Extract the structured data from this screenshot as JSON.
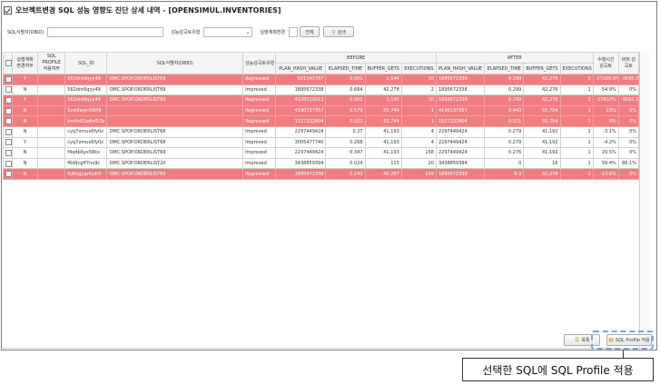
{
  "title": "오브젝트변경 SQL 성능 영향도 진단 상세 내역 - [OPENSIMUL.INVENTORIES]",
  "filters": {
    "sql_id_label": "SQL식별자(DBID)",
    "sql_id_value": "",
    "perf_type_label": "성능감곡토유형",
    "perf_type_value": "",
    "plan_change_label": "실행계획변경",
    "all_button": "전체",
    "search_button": "검색"
  },
  "table": {
    "group_headers": {
      "before": "BEFORE",
      "after": "AFTER"
    },
    "headers": {
      "plan_changed": "실행계획 변경여부",
      "sql_profile": "SQL PROFILE 적용여부",
      "sql_id": "SQL_ID",
      "sql_ident": "SQL식별자(DBID)",
      "perf_type": "성능감곡토유형",
      "plan_hash_value": "PLAN_HASH_VALUE",
      "elapsed_time": "ELAPSED_TIME",
      "buffer_gets": "BUFFER_GETS",
      "executions": "EXECUTIONS",
      "improve_time": "수행시간 감곡토",
      "ratio": "버퍼 감곡토"
    },
    "rows": [
      {
        "hl": true,
        "plan_changed": "Y",
        "sql_profile": "",
        "sql_id": "562dnt6qyy49",
        "sql_ident": "OMC.SPOP.ORDERLIST69",
        "perf_type": "Regressed",
        "b_plan": "921143787",
        "b_elapsed": "0.001",
        "b_buffer": "1,144",
        "b_exec": "10",
        "a_plan": "1895672338",
        "a_elapsed": "0.299",
        "a_buffer": "42,276",
        "a_exec": "2",
        "improve": "-27200.0%",
        "ratio": "-3595.3%"
      },
      {
        "hl": false,
        "plan_changed": "N",
        "sql_profile": "",
        "sql_id": "562dnt6qyy49",
        "sql_ident": "OMC.SPOP.ORDERLIST69",
        "perf_type": "Improved",
        "b_plan": "1895672338",
        "b_elapsed": "0.664",
        "b_buffer": "42,278",
        "b_exec": "2",
        "a_plan": "1895672338",
        "a_elapsed": "0.299",
        "a_buffer": "42,276",
        "a_exec": "1",
        "improve": "54.9%",
        "ratio": "0%"
      },
      {
        "hl": true,
        "plan_changed": "Y",
        "sql_profile": "",
        "sql_id": "562dnt6qyy49",
        "sql_ident": "OMC.SPOP.ORDERLIST69",
        "perf_type": "Regressed",
        "b_plan": "4108530012",
        "b_elapsed": "0.001",
        "b_buffer": "1,145",
        "b_exec": "10",
        "a_plan": "1895672338",
        "a_elapsed": "0.299",
        "a_buffer": "42,276",
        "a_exec": "1",
        "improve": "-27610%",
        "ratio": "-3592.2%"
      },
      {
        "hl": true,
        "plan_changed": "N",
        "sql_profile": "",
        "sql_id": "5xw8aqm5849",
        "sql_ident": "",
        "perf_type": "Regressed",
        "b_plan": "4190137357",
        "b_elapsed": "0.579",
        "b_buffer": "55,744",
        "b_exec": "1",
        "a_plan": "4190137357",
        "a_elapsed": "0.443",
        "a_buffer": "55,754",
        "a_exec": "1",
        "improve": "23%",
        "ratio": "0%"
      },
      {
        "hl": true,
        "plan_changed": "N",
        "sql_profile": "",
        "sql_id": "bm4c63q4vf57b",
        "sql_ident": "",
        "perf_type": "Regressed",
        "b_plan": "1527232804",
        "b_elapsed": "0.521",
        "b_buffer": "55,744",
        "b_exec": "1",
        "a_plan": "1527232804",
        "a_elapsed": "0.521",
        "a_buffer": "55,754",
        "a_exec": "1",
        "improve": "0%",
        "ratio": "0%"
      },
      {
        "hl": false,
        "plan_changed": "N",
        "sql_profile": "",
        "sql_id": "cyq7vmux6fy0z",
        "sql_ident": "OMC.SPOP.ORDERLIST68",
        "perf_type": "Improved",
        "b_plan": "2297449424",
        "b_elapsed": "0.27",
        "b_buffer": "41,193",
        "b_exec": "4",
        "a_plan": "2297449424",
        "a_elapsed": "0.279",
        "a_buffer": "41,192",
        "a_exec": "1",
        "improve": "-3.1%",
        "ratio": "0%"
      },
      {
        "hl": false,
        "plan_changed": "Y",
        "sql_profile": "",
        "sql_id": "cyq7vmux6fy0z",
        "sql_ident": "OMC.SPOP.ORDERLIST68",
        "perf_type": "Improved",
        "b_plan": "3005477740",
        "b_elapsed": "0.268",
        "b_buffer": "41,193",
        "b_exec": "4",
        "a_plan": "2297449424",
        "a_elapsed": "0.279",
        "a_buffer": "41,192",
        "a_exec": "1",
        "improve": "-4.2%",
        "ratio": "0%"
      },
      {
        "hl": false,
        "plan_changed": "N",
        "sql_profile": "",
        "sql_id": "f4q4b6yx58kx",
        "sql_ident": "OMC.SPOP.ORDERLIST69",
        "perf_type": "Improved",
        "b_plan": "2297449424",
        "b_elapsed": "0.347",
        "b_buffer": "41,193",
        "b_exec": "158",
        "a_plan": "2297449424",
        "a_elapsed": "0.276",
        "a_buffer": "41,192",
        "a_exec": "1",
        "improve": "20.5%",
        "ratio": "0%"
      },
      {
        "hl": false,
        "plan_changed": "N",
        "sql_profile": "",
        "sql_id": "f6dfjcgff7nx9c",
        "sql_ident": "OMC.SPOP.ORDERLIST20",
        "perf_type": "Improved",
        "b_plan": "3438859394",
        "b_elapsed": "0.024",
        "b_buffer": "115",
        "b_exec": "20",
        "a_plan": "3438859394",
        "a_elapsed": "0",
        "a_buffer": "16",
        "a_exec": "1",
        "improve": "99.4%",
        "ratio": "86.1%"
      },
      {
        "hl": true,
        "plan_changed": "N",
        "sql_profile": "",
        "sql_id": "fsj6egjup4ydr5",
        "sql_ident": "OMC.SPOP.ORDERLIST69",
        "perf_type": "Regressed",
        "b_plan": "1895672338",
        "b_elapsed": "0.243",
        "b_buffer": "42,267",
        "b_exec": "159",
        "a_plan": "1895672338",
        "a_elapsed": "0.3",
        "a_buffer": "42,276",
        "a_exec": "1",
        "improve": "-23.6%",
        "ratio": "0%"
      }
    ]
  },
  "footer": {
    "list_button": "목록",
    "apply_profile_button": "SQL Profile 적용"
  },
  "callout": "선택한 SQL에 SQL Profile 적용",
  "colors": {
    "highlight_row": "#ef7d7f",
    "dash_highlight": "#7aa7d6"
  }
}
